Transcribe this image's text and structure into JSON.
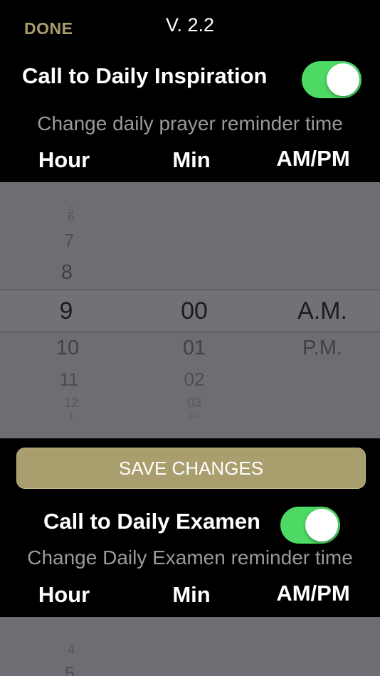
{
  "header": {
    "done_label": "DONE",
    "version": "V. 2.2"
  },
  "inspiration": {
    "toggle_label": "Call to Daily Inspiration",
    "toggle_on": true,
    "subtitle": "Change daily prayer reminder time",
    "columns": [
      "Hour",
      "Min",
      "AM/PM"
    ],
    "hour_wheel": [
      "5",
      "6",
      "7",
      "8",
      "9",
      "10",
      "11",
      "12",
      "1"
    ],
    "minute_wheel": [
      "00",
      "01",
      "02",
      "03",
      "04"
    ],
    "ampm_wheel": [
      "A.M.",
      "P.M."
    ],
    "selected": {
      "hour": "9",
      "minute": "00",
      "ampm": "A.M."
    }
  },
  "save_label": "SAVE CHANGES",
  "examen": {
    "toggle_label": "Call to Daily Examen",
    "toggle_on": true,
    "subtitle": "Change Daily Examen reminder time",
    "columns": [
      "Hour",
      "Min",
      "AM/PM"
    ],
    "hour_wheel": [
      "4",
      "5"
    ]
  },
  "colors": {
    "accent_gold": "#a99e6d",
    "toggle_green": "#4cd964",
    "picker_bg": "#6d6e73"
  }
}
